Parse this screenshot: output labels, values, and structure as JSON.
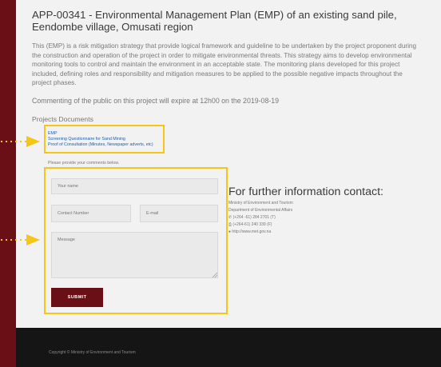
{
  "project": {
    "title": "APP-00341 - Environmental Management Plan (EMP) of an existing sand pile, Eendombe village, Omusati region",
    "description": "This (EMP) is a risk mitigation strategy that provide logical framework and guideline to be undertaken by the project proponent during the construction and operation of the project in order to mitigate environmental threats. This strategy aims to develop environmental monitoring tools to control and maintain the environment in an acceptable state. The monitoring plans developed for this project included, defining roles and responsibility and mitigation measures to be applied to the possible negative impacts throughout the project phases.",
    "expiry_text": "Commenting of the public on this project will expire at 12h00 on the 2019-08-19"
  },
  "documents": {
    "heading": "Projects Documents",
    "links": [
      "EMP",
      "Screening Questionnaire for Sand Mining",
      "Proof of Consultation (Minutes, Newspaper adverts, etc)"
    ]
  },
  "form": {
    "prompt": "Please provide your comments below.",
    "name_placeholder": "Your name",
    "contact_placeholder": "Contact Number",
    "email_placeholder": "E-mail",
    "message_placeholder": "Message",
    "submit_label": "SUBMIT"
  },
  "contact": {
    "heading": "For further information contact:",
    "org": "Ministry of Environment and Tourism",
    "dept": "Department of Environmental Affairs",
    "phone": "(+264 -61) 284 2701 (T)",
    "fax": "(+264-61) 240 339 (F)",
    "web": "http://www.met.gov.na"
  },
  "footer": {
    "copyright": "Copyright © Ministry of Environment and Tourism"
  },
  "colors": {
    "brand": "#6b0f17",
    "highlight": "#f5c518",
    "link": "#2060b0"
  }
}
